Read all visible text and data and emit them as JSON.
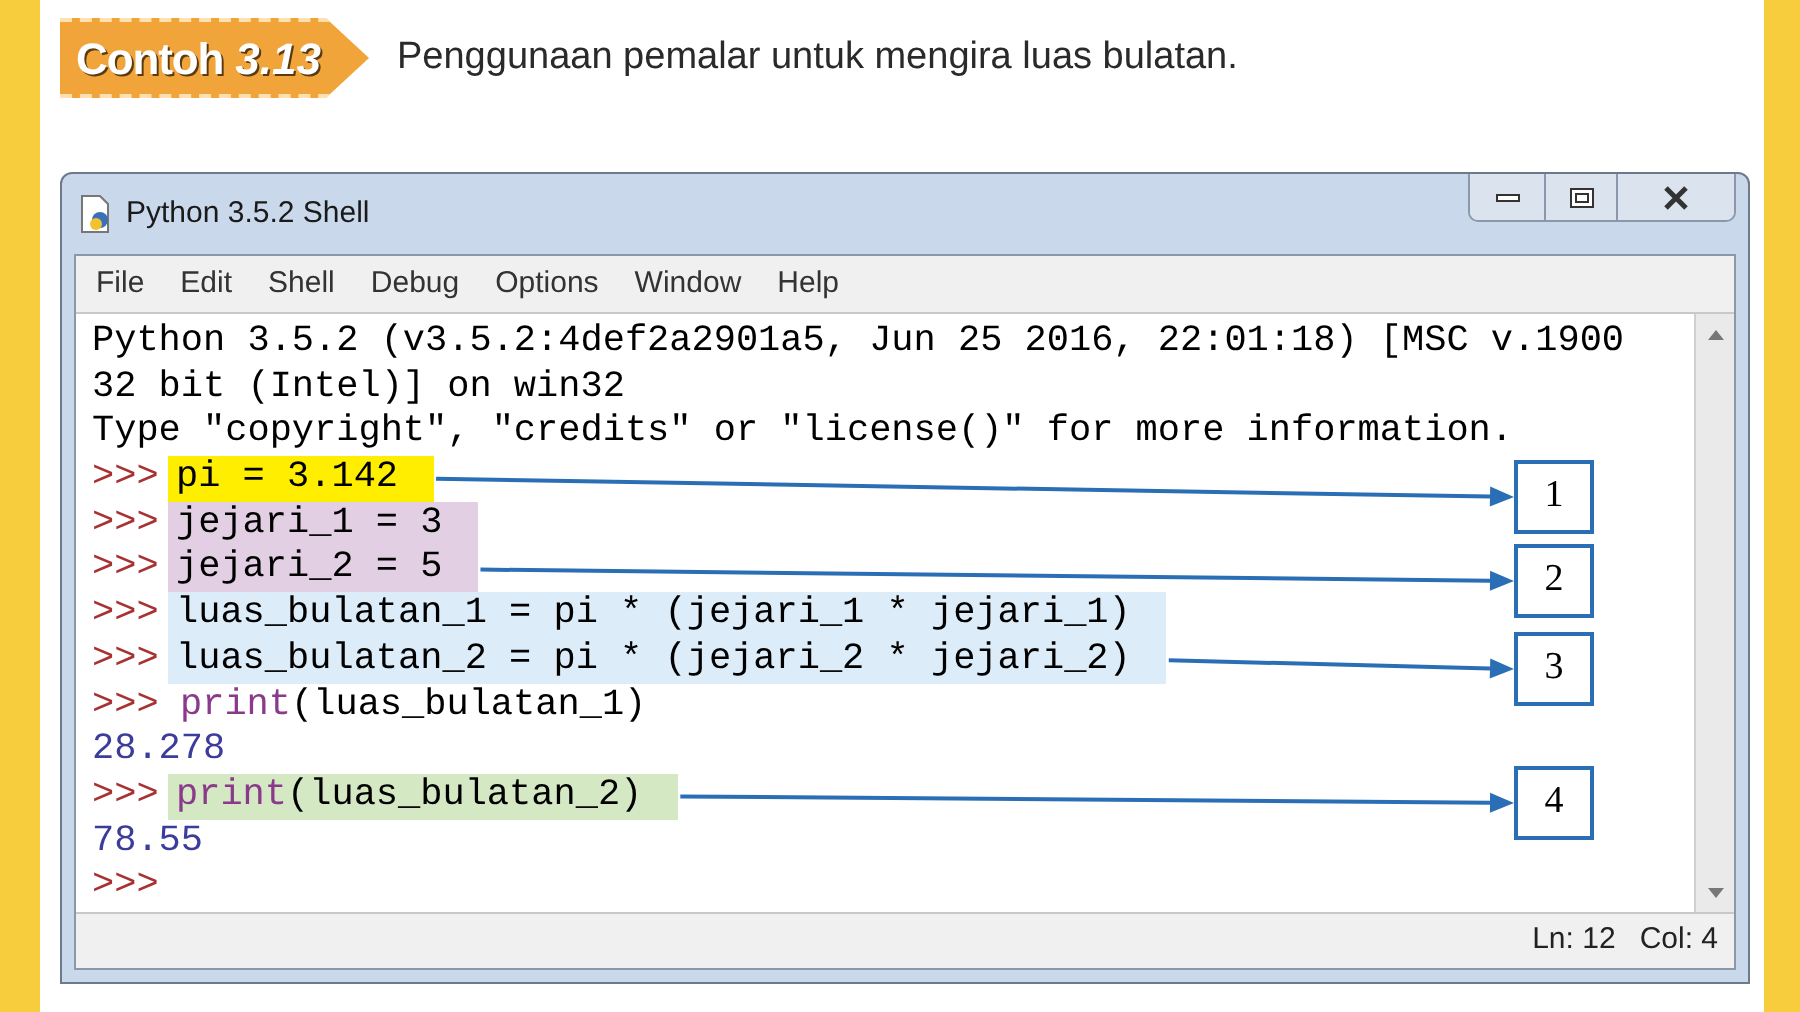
{
  "heading": {
    "badge_word": "Contoh",
    "badge_number": "3.13",
    "caption": "Penggunaan pemalar untuk mengira luas bulatan."
  },
  "window": {
    "title": "Python 3.5.2 Shell",
    "menu": [
      "File",
      "Edit",
      "Shell",
      "Debug",
      "Options",
      "Window",
      "Help"
    ],
    "status": [
      "Ln: 12",
      "Col: 4"
    ]
  },
  "shell": [
    {
      "kind": "output",
      "text": "Python 3.5.2 (v3.5.2:4def2a2901a5, Jun 25 2016, 22:01:18) [MSC v.1900"
    },
    {
      "kind": "output",
      "text": "32 bit (Intel)] on win32"
    },
    {
      "kind": "output",
      "text": "Type \"copyright\", \"credits\" or \"license()\" for more information."
    },
    {
      "kind": "group",
      "color": "#ffee00",
      "callout": "1",
      "lines": [
        {
          "prompt": ">>>",
          "segments": [
            {
              "kind": "plain",
              "text": "pi = 3.142"
            }
          ]
        }
      ]
    },
    {
      "kind": "group",
      "color": "#e2cfe3",
      "callout": "2",
      "lines": [
        {
          "prompt": ">>>",
          "segments": [
            {
              "kind": "plain",
              "text": "jejari_1 = 3"
            }
          ]
        },
        {
          "prompt": ">>>",
          "segments": [
            {
              "kind": "plain",
              "text": "jejari_2 = 5"
            }
          ]
        }
      ]
    },
    {
      "kind": "group",
      "color": "#dcecf8",
      "callout": "3",
      "lines": [
        {
          "prompt": ">>>",
          "segments": [
            {
              "kind": "plain",
              "text": "luas_bulatan_1 = pi * (jejari_1 * jejari_1)"
            }
          ]
        },
        {
          "prompt": ">>>",
          "segments": [
            {
              "kind": "plain",
              "text": "luas_bulatan_2 = pi * (jejari_2 * jejari_2)"
            }
          ]
        }
      ]
    },
    {
      "kind": "input",
      "prompt": ">>>",
      "segments": [
        {
          "kind": "builtin",
          "text": "print"
        },
        {
          "kind": "plain",
          "text": "(luas_bulatan_1)"
        }
      ]
    },
    {
      "kind": "result",
      "text": "28.278"
    },
    {
      "kind": "group",
      "color": "#d4e8c4",
      "callout": "4",
      "lines": [
        {
          "prompt": ">>>",
          "segments": [
            {
              "kind": "builtin",
              "text": "print"
            },
            {
              "kind": "plain",
              "text": "(luas_bulatan_2)"
            }
          ]
        }
      ]
    },
    {
      "kind": "result",
      "text": "78.55"
    },
    {
      "kind": "input",
      "prompt": ">>>"
    }
  ]
}
